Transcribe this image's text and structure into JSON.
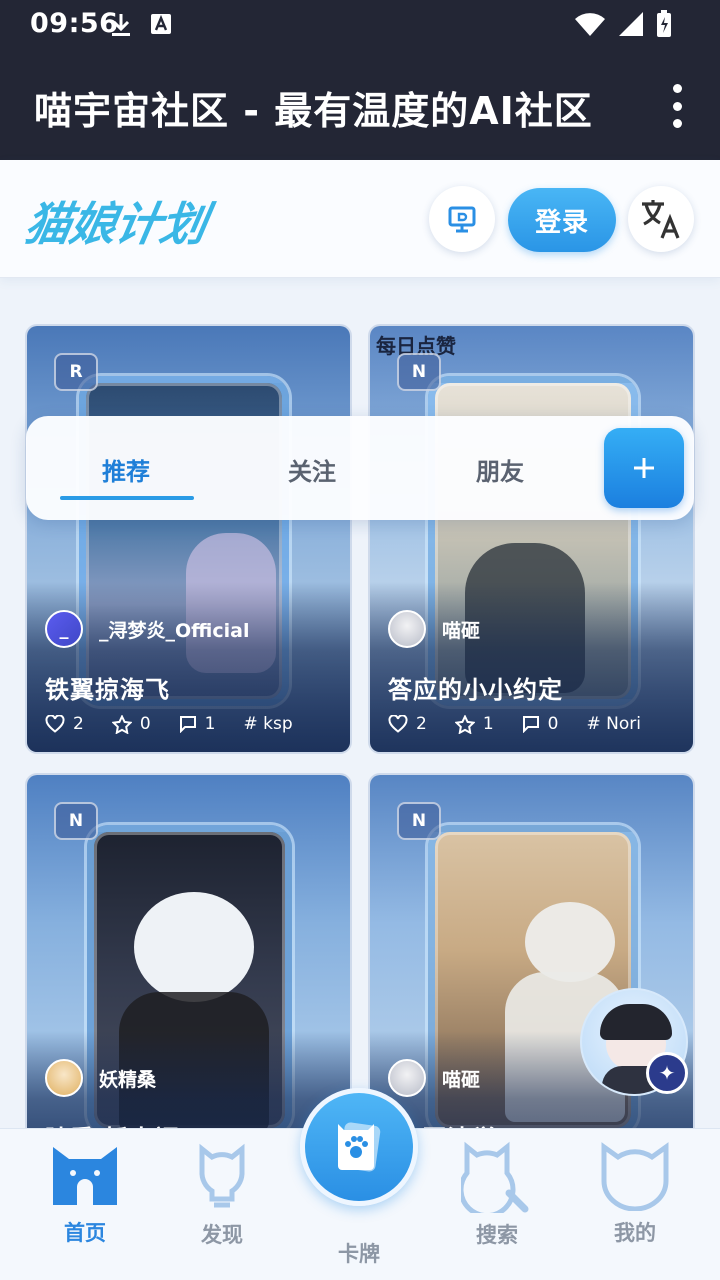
{
  "status_bar": {
    "time": "09:56"
  },
  "app_bar": {
    "title": "喵宇宙社区 - 最有温度的AI社区"
  },
  "header": {
    "logo_text": "猫娘计划",
    "login_label": "登录"
  },
  "tabs": [
    {
      "label": "推荐",
      "active": true
    },
    {
      "label": "关注",
      "active": false
    },
    {
      "label": "朋友",
      "active": false
    }
  ],
  "cards": [
    {
      "rarity": "R",
      "author": "_浔梦炎_Official",
      "avatar_text": "_",
      "title": "铁翼掠海飞",
      "likes": "2",
      "stars": "0",
      "comments": "1",
      "tag": "# ksp"
    },
    {
      "rarity": "N",
      "badge": "每日点赞",
      "author": "喵砸",
      "title": "答应的小小约定",
      "likes": "2",
      "stars": "1",
      "comments": "0",
      "tag": "# Nori"
    },
    {
      "rarity": "N",
      "author": "妖精桑",
      "title": "陆重 娇幸福"
    },
    {
      "rarity": "N",
      "author": "喵砸",
      "title": "陆 国清觉"
    }
  ],
  "bottom_nav": [
    {
      "label": "首页",
      "icon": "home-cat-icon",
      "active": true
    },
    {
      "label": "发现",
      "icon": "lightbulb-cat-icon",
      "active": false
    },
    {
      "label": "卡牌",
      "icon": "cards-paw-icon",
      "active": false
    },
    {
      "label": "搜索",
      "icon": "search-cat-icon",
      "active": false
    },
    {
      "label": "我的",
      "icon": "profile-cat-icon",
      "active": false
    }
  ],
  "colors": {
    "app_bar": "#232635",
    "accent": "#2a95e6",
    "logo": "#3ab7e6"
  }
}
